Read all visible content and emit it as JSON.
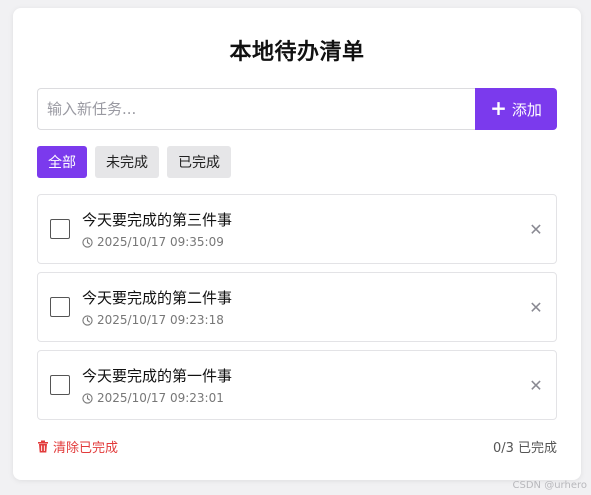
{
  "app": {
    "title": "本地待办清单"
  },
  "input": {
    "placeholder": "输入新任务...",
    "value": ""
  },
  "add_button": {
    "icon": "plus-icon",
    "label": "添加"
  },
  "filters": [
    {
      "label": "全部",
      "active": true
    },
    {
      "label": "未完成",
      "active": false
    },
    {
      "label": "已完成",
      "active": false
    }
  ],
  "todos": [
    {
      "text": "今天要完成的第三件事",
      "time": "2025/10/17 09:35:09",
      "done": false
    },
    {
      "text": "今天要完成的第二件事",
      "time": "2025/10/17 09:23:18",
      "done": false
    },
    {
      "text": "今天要完成的第一件事",
      "time": "2025/10/17 09:23:01",
      "done": false
    }
  ],
  "footer": {
    "clear_label": "清除已完成",
    "stats": "0/3 已完成"
  },
  "watermark": "CSDN @urhero",
  "colors": {
    "accent": "#7b3aed",
    "danger": "#e23b3b",
    "muted": "#8a8a93",
    "background": "#f1f1f3"
  }
}
